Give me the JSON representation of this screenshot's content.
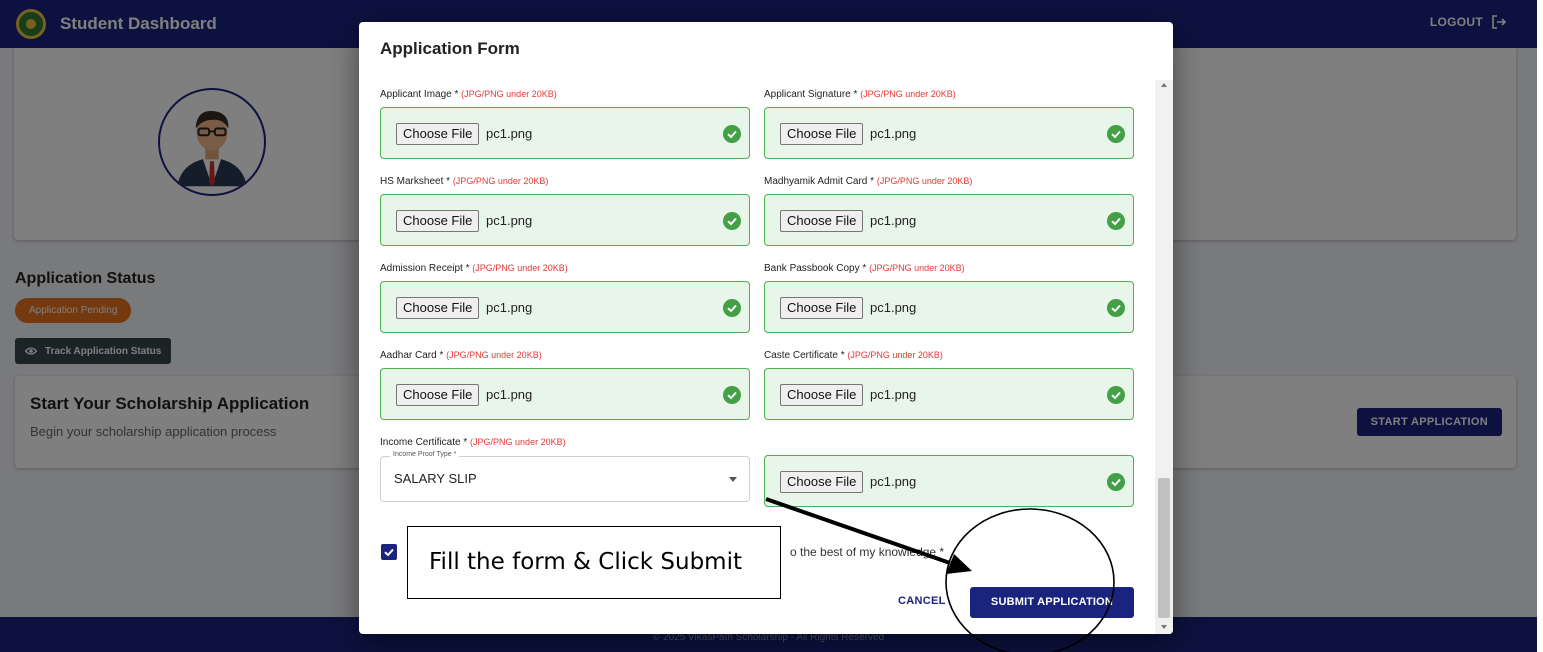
{
  "appbar": {
    "title": "Student Dashboard",
    "logout_label": "LOGOUT"
  },
  "status": {
    "title": "Application Status",
    "chip": "Application Pending",
    "track_button": "Track Application Status"
  },
  "start": {
    "title": "Start Your Scholarship Application",
    "subtitle": "Begin your scholarship application process",
    "button": "START APPLICATION"
  },
  "footer": {
    "text": "© 2025 VikasPath Scholarship - All Rights Reserved"
  },
  "dialog": {
    "title": "Application Form",
    "required_hint": "(JPG/PNG under 20KB)",
    "choose_file_label": "Choose File",
    "fields": [
      {
        "label": "Applicant Image *",
        "file": "pc1.png"
      },
      {
        "label": "Applicant Signature *",
        "file": "pc1.png"
      },
      {
        "label": "HS Marksheet *",
        "file": "pc1.png"
      },
      {
        "label": "Madhyamik Admit Card *",
        "file": "pc1.png"
      },
      {
        "label": "Admission Receipt *",
        "file": "pc1.png"
      },
      {
        "label": "Bank Passbook Copy *",
        "file": "pc1.png"
      },
      {
        "label": "Aadhar Card *",
        "file": "pc1.png"
      },
      {
        "label": "Caste Certificate *",
        "file": "pc1.png"
      },
      {
        "label": "Income Certificate *",
        "file": "pc1.png"
      }
    ],
    "income_proof": {
      "legend": "Income Proof Type *",
      "value": "SALARY SLIP"
    },
    "agreement_text": "o the best of my knowledge *",
    "agreement_checked": true,
    "cancel_label": "CANCEL",
    "submit_label": "SUBMIT APPLICATION"
  },
  "annotation": {
    "callout_text": "Fill the form & Click Submit"
  },
  "colors": {
    "primary": "#1a237e",
    "success": "#43a047",
    "success_bg": "#e8f5e9",
    "pending": "#e8731f",
    "required": "#e53935"
  }
}
